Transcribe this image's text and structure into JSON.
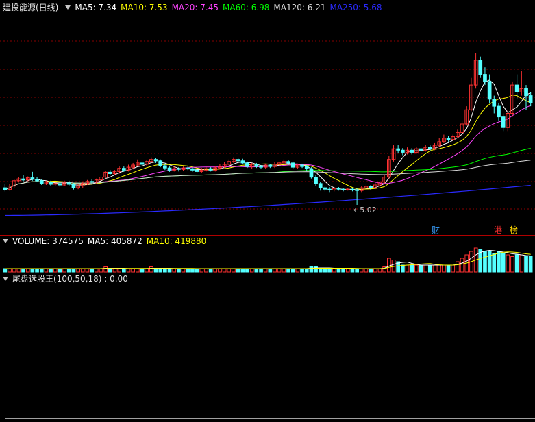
{
  "price_panel": {
    "title": "建投能源(日线)",
    "indicators": [
      {
        "label": "MA5: 7.34",
        "color": "#ffffff"
      },
      {
        "label": "MA10: 7.53",
        "color": "#ffff00"
      },
      {
        "label": "MA20: 7.45",
        "color": "#ff44ff"
      },
      {
        "label": "MA60: 6.98",
        "color": "#00ff00"
      },
      {
        "label": "MA120: 6.21",
        "color": "#d8d8d8"
      },
      {
        "label": "MA250: 5.68",
        "color": "#2a2aff"
      }
    ],
    "low_marker": "5.02",
    "event_tags": [
      {
        "text": "财",
        "color": "#3aa0ff"
      },
      {
        "text": "港",
        "color": "#ff3030"
      },
      {
        "text": "榜",
        "color": "#ffd700"
      }
    ]
  },
  "volume_panel": {
    "indicators": [
      {
        "label": "VOLUME: 374575",
        "color": "#ffffff"
      },
      {
        "label": "MA5: 405872",
        "color": "#ffffff"
      },
      {
        "label": "MA10: 419880",
        "color": "#ffff00"
      }
    ]
  },
  "signal_panel": {
    "title": "尾盘选股王(100,50,18) : 0.00"
  },
  "colors": {
    "up": "#ff3232",
    "down": "#54ffff",
    "grid": "#8a0000"
  },
  "chart_data": {
    "type": "candlestick",
    "candles": [
      [
        5.5,
        5.45,
        5.6,
        5.4
      ],
      [
        5.45,
        5.55,
        5.6,
        5.42
      ],
      [
        5.55,
        5.7,
        5.75,
        5.5
      ],
      [
        5.7,
        5.75,
        5.8,
        5.65
      ],
      [
        5.75,
        5.72,
        5.85,
        5.68
      ],
      [
        5.72,
        5.78,
        5.82,
        5.7
      ],
      [
        5.78,
        5.74,
        5.95,
        5.7
      ],
      [
        5.74,
        5.7,
        5.8,
        5.66
      ],
      [
        5.7,
        5.62,
        5.75,
        5.58
      ],
      [
        5.62,
        5.66,
        5.7,
        5.58
      ],
      [
        5.66,
        5.6,
        5.7,
        5.55
      ],
      [
        5.6,
        5.62,
        5.68,
        5.56
      ],
      [
        5.62,
        5.58,
        5.66,
        5.52
      ],
      [
        5.58,
        5.64,
        5.7,
        5.55
      ],
      [
        5.64,
        5.6,
        5.7,
        5.56
      ],
      [
        5.6,
        5.5,
        5.64,
        5.45
      ],
      [
        5.5,
        5.55,
        5.6,
        5.46
      ],
      [
        5.55,
        5.62,
        5.66,
        5.5
      ],
      [
        5.62,
        5.68,
        5.72,
        5.58
      ],
      [
        5.68,
        5.66,
        5.74,
        5.62
      ],
      [
        5.66,
        5.72,
        5.76,
        5.62
      ],
      [
        5.72,
        5.8,
        5.85,
        5.68
      ],
      [
        5.8,
        5.94,
        5.98,
        5.76
      ],
      [
        5.94,
        5.9,
        6.0,
        5.86
      ],
      [
        5.9,
        5.96,
        6.0,
        5.86
      ],
      [
        5.96,
        6.05,
        6.1,
        5.9
      ],
      [
        6.05,
        6.0,
        6.1,
        5.95
      ],
      [
        6.0,
        6.08,
        6.15,
        5.96
      ],
      [
        6.08,
        6.14,
        6.2,
        6.02
      ],
      [
        6.14,
        6.2,
        6.3,
        6.1
      ],
      [
        6.2,
        6.16,
        6.24,
        6.1
      ],
      [
        6.16,
        6.24,
        6.28,
        6.12
      ],
      [
        6.24,
        6.3,
        6.36,
        6.2
      ],
      [
        6.3,
        6.26,
        6.34,
        6.2
      ],
      [
        6.26,
        6.12,
        6.3,
        6.08
      ],
      [
        6.12,
        6.06,
        6.16,
        6.0
      ],
      [
        6.06,
        6.0,
        6.1,
        5.95
      ],
      [
        6.0,
        6.04,
        6.1,
        5.96
      ],
      [
        6.04,
        6.02,
        6.08,
        5.96
      ],
      [
        6.02,
        6.06,
        6.1,
        5.98
      ],
      [
        6.06,
        6.04,
        6.12,
        6.0
      ],
      [
        6.04,
        6.0,
        6.08,
        5.95
      ],
      [
        6.0,
        5.96,
        6.04,
        5.92
      ],
      [
        5.96,
        6.0,
        6.06,
        5.92
      ],
      [
        6.0,
        6.04,
        6.08,
        5.96
      ],
      [
        6.04,
        6.0,
        6.08,
        5.96
      ],
      [
        6.0,
        6.06,
        6.12,
        5.96
      ],
      [
        6.06,
        6.1,
        6.16,
        6.02
      ],
      [
        6.1,
        6.16,
        6.22,
        6.06
      ],
      [
        6.16,
        6.24,
        6.3,
        6.12
      ],
      [
        6.24,
        6.3,
        6.36,
        6.2
      ],
      [
        6.3,
        6.26,
        6.34,
        6.22
      ],
      [
        6.26,
        6.2,
        6.32,
        6.16
      ],
      [
        6.2,
        6.1,
        6.24,
        6.06
      ],
      [
        6.1,
        6.16,
        6.2,
        6.04
      ],
      [
        6.16,
        6.1,
        6.2,
        6.06
      ],
      [
        6.1,
        6.08,
        6.14,
        6.04
      ],
      [
        6.08,
        6.14,
        6.18,
        6.04
      ],
      [
        6.14,
        6.1,
        6.16,
        6.06
      ],
      [
        6.1,
        6.16,
        6.22,
        6.06
      ],
      [
        6.16,
        6.2,
        6.24,
        6.12
      ],
      [
        6.2,
        6.24,
        6.3,
        6.16
      ],
      [
        6.24,
        6.2,
        6.28,
        6.14
      ],
      [
        6.2,
        6.08,
        6.24,
        6.04
      ],
      [
        6.08,
        6.14,
        6.18,
        6.04
      ],
      [
        6.14,
        6.1,
        6.18,
        6.06
      ],
      [
        6.1,
        6.04,
        6.14,
        5.98
      ],
      [
        6.04,
        5.8,
        6.08,
        5.76
      ],
      [
        5.8,
        5.62,
        5.86,
        5.56
      ],
      [
        5.62,
        5.5,
        5.66,
        5.42
      ],
      [
        5.5,
        5.46,
        5.56,
        5.4
      ],
      [
        5.46,
        5.44,
        5.52,
        5.38
      ],
      [
        5.44,
        5.48,
        5.52,
        5.4
      ],
      [
        5.48,
        5.46,
        5.52,
        5.42
      ],
      [
        5.46,
        5.44,
        5.5,
        5.4
      ],
      [
        5.44,
        5.46,
        5.5,
        5.42
      ],
      [
        5.46,
        5.44,
        5.5,
        5.4
      ],
      [
        5.44,
        5.42,
        5.48,
        5.02
      ],
      [
        5.42,
        5.5,
        5.56,
        5.38
      ],
      [
        5.5,
        5.54,
        5.6,
        5.46
      ],
      [
        5.54,
        5.5,
        5.58,
        5.44
      ],
      [
        5.5,
        5.58,
        5.64,
        5.46
      ],
      [
        5.58,
        5.66,
        5.72,
        5.54
      ],
      [
        5.66,
        5.8,
        5.86,
        5.62
      ],
      [
        5.8,
        6.3,
        6.4,
        5.76
      ],
      [
        6.3,
        6.6,
        6.7,
        6.24
      ],
      [
        6.6,
        6.56,
        6.7,
        6.48
      ],
      [
        6.56,
        6.5,
        6.62,
        6.42
      ],
      [
        6.5,
        6.56,
        6.64,
        6.44
      ],
      [
        6.56,
        6.5,
        6.62,
        6.44
      ],
      [
        6.5,
        6.6,
        6.66,
        6.46
      ],
      [
        6.6,
        6.56,
        6.66,
        6.5
      ],
      [
        6.56,
        6.64,
        6.72,
        6.52
      ],
      [
        6.64,
        6.6,
        6.7,
        6.54
      ],
      [
        6.6,
        6.7,
        6.76,
        6.56
      ],
      [
        6.7,
        6.8,
        6.9,
        6.66
      ],
      [
        6.8,
        6.9,
        7.0,
        6.76
      ],
      [
        6.9,
        6.86,
        6.96,
        6.8
      ],
      [
        6.86,
        6.94,
        7.0,
        6.82
      ],
      [
        6.94,
        7.06,
        7.14,
        6.9
      ],
      [
        7.06,
        7.3,
        7.4,
        7.02
      ],
      [
        7.3,
        7.7,
        7.8,
        7.26
      ],
      [
        7.7,
        8.4,
        8.6,
        7.66
      ],
      [
        8.4,
        9.1,
        9.3,
        8.3
      ],
      [
        9.1,
        8.7,
        9.2,
        8.6
      ],
      [
        8.7,
        8.5,
        8.9,
        8.4
      ],
      [
        8.5,
        8.0,
        8.7,
        7.9
      ],
      [
        8.0,
        7.8,
        8.1,
        7.6
      ],
      [
        7.8,
        7.5,
        7.9,
        7.4
      ],
      [
        7.5,
        7.2,
        7.6,
        7.1
      ],
      [
        7.2,
        7.6,
        7.7,
        7.1
      ],
      [
        7.6,
        8.4,
        8.5,
        7.5
      ],
      [
        8.4,
        8.2,
        8.7,
        8.0
      ],
      [
        8.2,
        8.3,
        8.8,
        8.1
      ],
      [
        8.3,
        8.1,
        8.4,
        7.7
      ],
      [
        8.1,
        7.9,
        8.2,
        7.8
      ]
    ],
    "volume_ma": {
      "MA5": 405872,
      "MA10": 419880
    },
    "volume": [
      2,
      2,
      2,
      2,
      2,
      2,
      2,
      2,
      2,
      2,
      2,
      2,
      2,
      2,
      2,
      2,
      2,
      2,
      2,
      2,
      2,
      2,
      3,
      2,
      2,
      2,
      2,
      2,
      2,
      2,
      2,
      2,
      3,
      2,
      2,
      2,
      2,
      2,
      2,
      2,
      2,
      2,
      2,
      2,
      2,
      2,
      2,
      2,
      2,
      2,
      2,
      2,
      2,
      2,
      2,
      2,
      2,
      2,
      2,
      2,
      2,
      2,
      2,
      2,
      2,
      2,
      2,
      3,
      3,
      2,
      2,
      2,
      2,
      2,
      2,
      2,
      2,
      2,
      2,
      2,
      2,
      2,
      2,
      3,
      8,
      7,
      6,
      4,
      4,
      4,
      4,
      4,
      4,
      4,
      4,
      4,
      4,
      4,
      4,
      6,
      8,
      10,
      12,
      14,
      13,
      12,
      12,
      11,
      12,
      11,
      10,
      9,
      10,
      10,
      9,
      9
    ],
    "signal": [
      0,
      0,
      0,
      0,
      0,
      0,
      0,
      0,
      0,
      0,
      0,
      0,
      0,
      0,
      0,
      0,
      0,
      0,
      0,
      0,
      0,
      0,
      0,
      0,
      0,
      0,
      0,
      0,
      0,
      0,
      0,
      0,
      0,
      0,
      0,
      0,
      0,
      0,
      0,
      0,
      0,
      0,
      0,
      0,
      0,
      0,
      0,
      0,
      0,
      0,
      0,
      0,
      0,
      0,
      0,
      0,
      0,
      0,
      0,
      0,
      0,
      0,
      0,
      0,
      0,
      0,
      0,
      0,
      0,
      0,
      0,
      0,
      0,
      0,
      0,
      0,
      0,
      0,
      0,
      0,
      0,
      0,
      0,
      0,
      0,
      0,
      0,
      0,
      0,
      0,
      0,
      0,
      0,
      0,
      0,
      0,
      0,
      0,
      0,
      0,
      0,
      0,
      0,
      0,
      0,
      0,
      0,
      0,
      0,
      0,
      0,
      0,
      0,
      0,
      0,
      0,
      0,
      0,
      0,
      0
    ]
  }
}
